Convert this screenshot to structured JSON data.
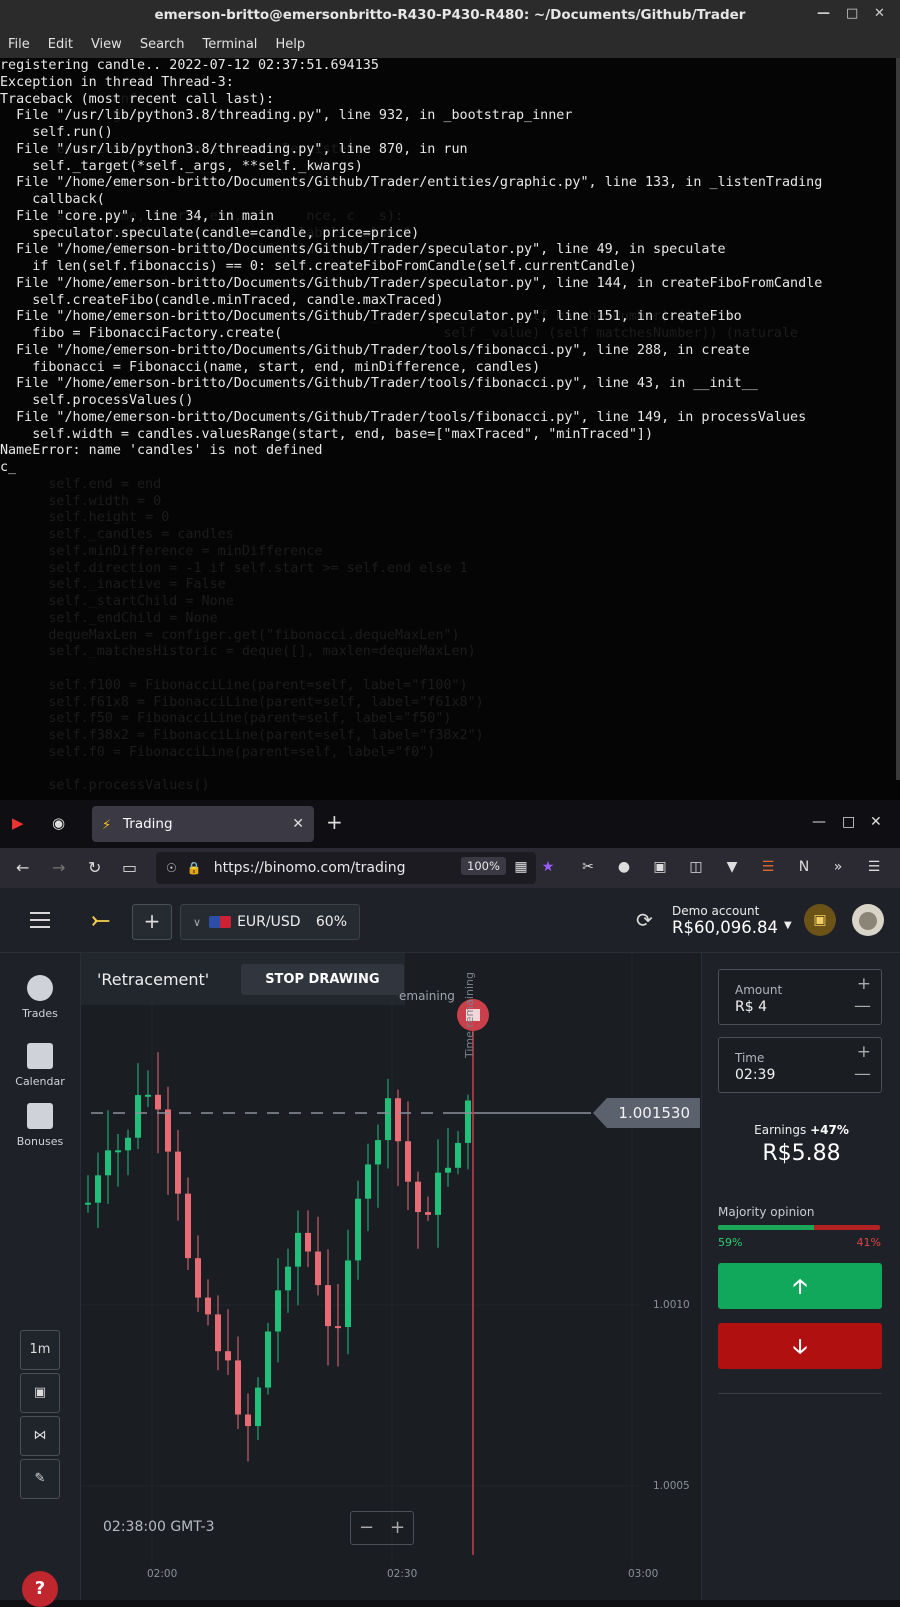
{
  "terminal": {
    "title": "emerson-britto@emersonbritto-R430-P430-R480: ~/Documents/Github/Trader",
    "menu": [
      "File",
      "Edit",
      "View",
      "Search",
      "Terminal",
      "Help"
    ],
    "lines": [
      "registering candle.. 2022-07-12 02:37:51.694135",
      "Exception in thread Thread-3:",
      "Traceback (most recent call last):",
      "  File \"/usr/lib/python3.8/threading.py\", line 932, in _bootstrap_inner",
      "    self.run()",
      "  File \"/usr/lib/python3.8/threading.py\", line 870, in run",
      "    self._target(*self._args, **self._kwargs)",
      "  File \"/home/emerson-britto/Documents/Github/Trader/entities/graphic.py\", line 133, in _listenTrading",
      "    callback(",
      "  File \"core.py\", line 34, in main",
      "    speculator.speculate(candle=candle, price=price)",
      "  File \"/home/emerson-britto/Documents/Github/Trader/speculator.py\", line 49, in speculate",
      "    if len(self.fibonaccis) == 0: self.createFiboFromCandle(self.currentCandle)",
      "  File \"/home/emerson-britto/Documents/Github/Trader/speculator.py\", line 144, in createFiboFromCandle",
      "    self.createFibo(candle.minTraced, candle.maxTraced)",
      "  File \"/home/emerson-britto/Documents/Github/Trader/speculator.py\", line 151, in createFibo",
      "    fibo = FibonacciFactory.create(",
      "  File \"/home/emerson-britto/Documents/Github/Trader/tools/fibonacci.py\", line 288, in create",
      "    fibonacci = Fibonacci(name, start, end, minDifference, candles)",
      "  File \"/home/emerson-britto/Documents/Github/Trader/tools/fibonacci.py\", line 43, in __init__",
      "    self.processValues()",
      "  File \"/home/emerson-britto/Documents/Github/Trader/tools/fibonacci.py\", line 149, in processValues",
      "    self.width = candles.valuesRange(start, end, base=[\"maxTraced\", \"minTraced\"])",
      "NameError: name 'candles' is not defined",
      "c_"
    ],
    "ghost_lines": [
      "",
      "",
      "              onfiger",
      "              ger",
      "",
      "       entities.Persistence import Persistence",
      "",
      "",
      "",
      "       self, name, start, end, min    nce, c   s):",
      "            super().__init__(parent, label, value=0)",
      "            self.name = name, self.value)",
      "",
      "",
      "",
      "                                              _value  ime_base  self matchesNumber) (inacti",
      "                                                       self _value) (self matchesNumber)) (naturale",
      "",
      "",
      "",
      "",
      "",
      "",
      "",
      "",
      "      self.end = end",
      "      self.width = 0",
      "      self.height = 0",
      "      self._candles = candles",
      "      self.minDifference = minDifference",
      "      self.direction = -1 if self.start >= self.end else 1",
      "      self._inactive = False",
      "      self._startChild = None",
      "      self._endChild = None",
      "      dequeMaxLen = configer.get(\"fibonacci.dequeMaxLen\")",
      "      self._matchesHistoric = deque([], maxlen=dequeMaxLen)",
      "",
      "      self.f100 = FibonacciLine(parent=self, label=\"f100\")",
      "      self.f61x8 = FibonacciLine(parent=self, label=\"f61x8\")",
      "      self.f50 = FibonacciLine(parent=self, label=\"f50\")",
      "      self.f38x2 = FibonacciLine(parent=self, label=\"f38x2\")",
      "      self.f0 = FibonacciLine(parent=self, label=\"f0\")",
      "",
      "      self.processValues()"
    ]
  },
  "browser": {
    "tab_title": "Trading",
    "url": "https://binomo.com/trading",
    "zoom": "100%"
  },
  "app": {
    "asset": "EUR/USD",
    "asset_payout": "60%",
    "account_label": "Demo account",
    "balance": "R$60,096.84",
    "nav": [
      {
        "label": "Trades",
        "icon": "clock-icon"
      },
      {
        "label": "Calendar",
        "icon": "calendar-icon"
      },
      {
        "label": "Bonuses",
        "icon": "gift-icon"
      }
    ],
    "timeframe": "1m",
    "drawing_name": "'Retracement'",
    "stop_drawing": "STOP DRAWING",
    "remaining_top": "emaining",
    "time_remaining": "Time remaining",
    "current_price": "1.001530",
    "time_caption": "02:38:00 GMT-3",
    "amount_label": "Amount",
    "amount_value": "R$ 4",
    "time_label": "Time",
    "time_value": "02:39",
    "earnings_label": "Earnings",
    "earnings_pct": "+47%",
    "earnings_value": "R$5.88",
    "majority_label": "Majority opinion",
    "majority_up": 59,
    "majority_up_text": "59%",
    "majority_down_text": "41%"
  },
  "chart_data": {
    "type": "candlestick",
    "y_tick_labels": [
      "1.0010",
      "1.0005"
    ],
    "x_tick_labels": [
      "02:00",
      "02:30",
      "03:00"
    ],
    "current_price": 1.00153
  }
}
